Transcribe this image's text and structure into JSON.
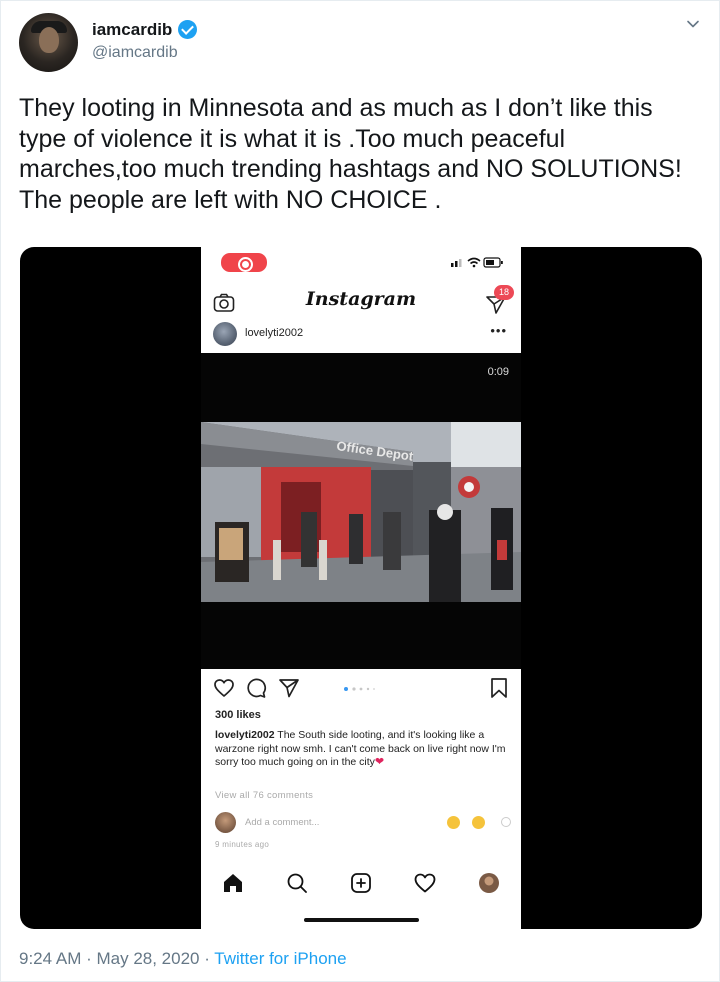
{
  "author": {
    "name": "iamcardib",
    "handle": "@iamcardib",
    "verified": true
  },
  "tweet": {
    "text": "They looting in Minnesota and as much as I don’t like this type of violence it is what it is .Too much peaceful marches,too much trending hashtags and NO SOLUTIONS! The people are left with NO CHOICE .",
    "timestamp": "9:24 AM · May 28, 2020 · ",
    "source": "Twitter for iPhone"
  },
  "media": {
    "instagram": {
      "logo": "Instagram",
      "dm_badge": "18",
      "username": "lovelyti2002",
      "more": "•••",
      "video_timer": "0:09",
      "likes": "300 likes",
      "caption_user": "lovelyti2002",
      "caption_text": " The South side looting, and it's looking like a warzone right now smh. I can't come back on live right now I'm sorry too much going on in the city",
      "view_all": "View all 76 comments",
      "add_comment": "Add a comment...",
      "time_ago": "9 minutes ago",
      "store_sign": "Office Depot"
    }
  },
  "icons": [
    "chevron-down-icon",
    "verified-icon",
    "camera-icon",
    "send-icon",
    "heart-icon",
    "comment-icon",
    "share-icon",
    "bookmark-icon",
    "home-icon",
    "search-icon",
    "add-icon",
    "activity-icon",
    "profile-icon"
  ],
  "colors": {
    "accent": "#1da1f2",
    "secondary_text": "#657786",
    "badge": "#ed4956",
    "record": "#f0444a"
  }
}
